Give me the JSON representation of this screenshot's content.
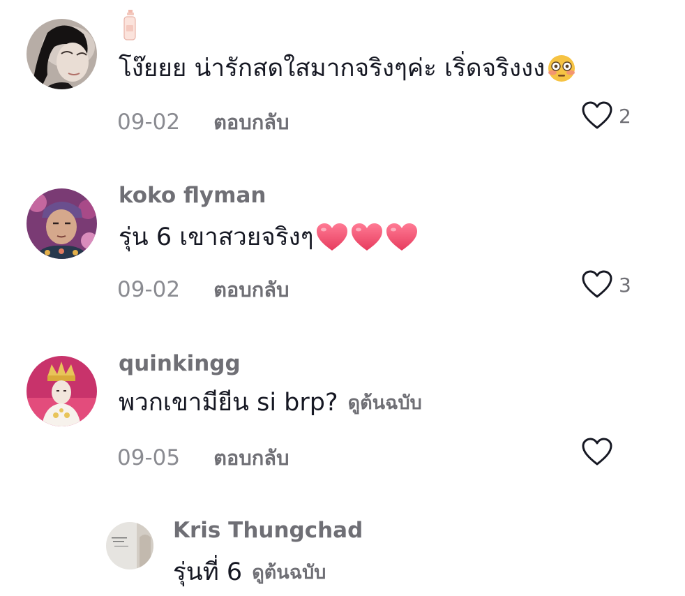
{
  "comments": [
    {
      "username": "",
      "text": "โง๊ยยย น่ารักสดใสมากจริงๆค่ะ เริ่ดจริงงง",
      "emoji": "flushed-face",
      "see_original": "",
      "date": "09-02",
      "reply_label": "ตอบกลับ",
      "likes": "2"
    },
    {
      "username": "koko flyman",
      "text": "รุ่น 6 เขาสวยจริงๆ",
      "emoji": "red-heart x3",
      "see_original": "",
      "date": "09-02",
      "reply_label": "ตอบกลับ",
      "likes": "3"
    },
    {
      "username": "quinkingg",
      "text": "พวกเขามียีน si brp?",
      "see_original": "ดูต้นฉบับ",
      "date": "09-05",
      "reply_label": "ตอบกลับ",
      "likes": ""
    },
    {
      "username": "Kris Thungchad",
      "text": "รุ่นที่ 6",
      "see_original": "ดูต้นฉบับ"
    }
  ],
  "colors": {
    "text": "#161823",
    "secondary": "#6f6f75",
    "date": "#8a8b91",
    "heart_emoji": "#f0506e"
  },
  "icons": {
    "like": "heart-outline-icon",
    "profile_badge": "lotion-bottle-icon"
  }
}
